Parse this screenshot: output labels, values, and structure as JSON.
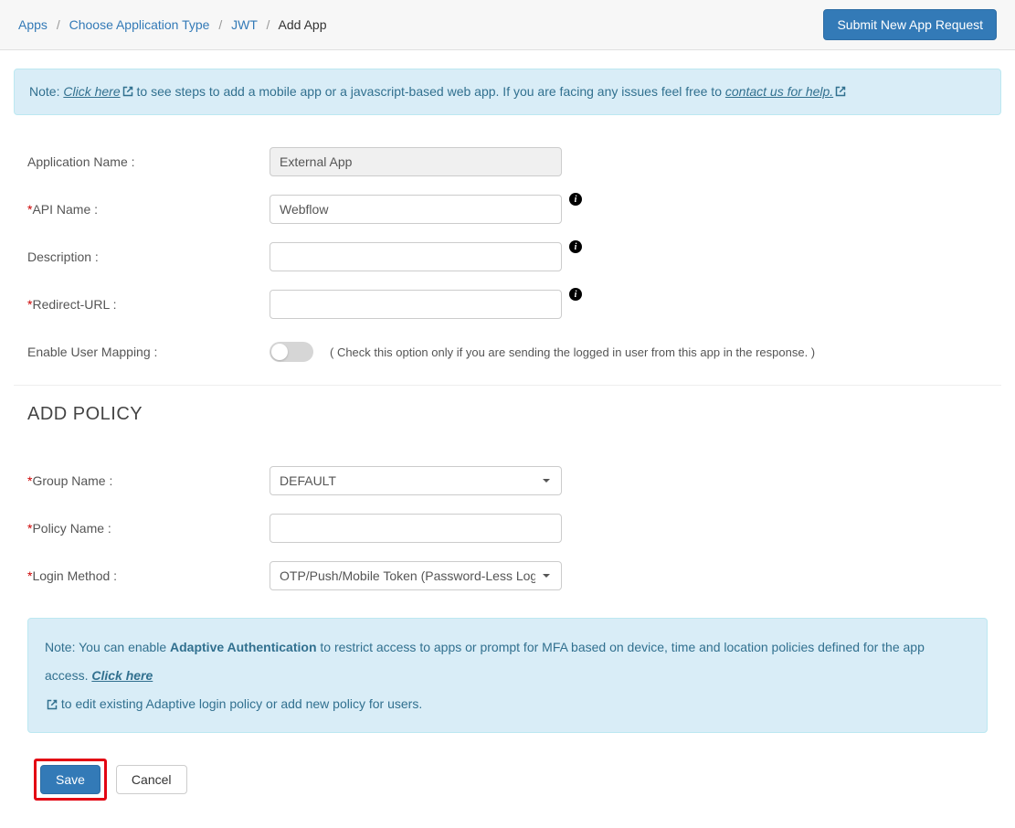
{
  "breadcrumb": {
    "apps": "Apps",
    "choose": "Choose Application Type",
    "jwt": "JWT",
    "current": "Add App"
  },
  "header": {
    "submit_label": "Submit New App Request"
  },
  "note1": {
    "prefix": "Note: ",
    "click_here": "Click here",
    "middle": " to see steps to add a mobile app or a javascript-based web app. If you are facing any issues feel free to ",
    "contact": "contact us for help."
  },
  "form": {
    "app_name_label": "Application Name :",
    "app_name_value": "External App",
    "api_name_label": "API Name :",
    "api_name_value": "Webflow",
    "description_label": "Description :",
    "description_value": "",
    "redirect_label": "Redirect-URL :",
    "redirect_value": "",
    "enable_mapping_label": "Enable User Mapping :",
    "enable_mapping_help": "( Check this option only if you are sending the logged in user from this app in the response. )"
  },
  "policy": {
    "title": "ADD POLICY",
    "group_label": "Group Name :",
    "group_value": "DEFAULT",
    "policy_name_label": "Policy Name :",
    "policy_name_value": "",
    "login_method_label": "Login Method :",
    "login_method_value": "OTP/Push/Mobile Token (Password-Less Login"
  },
  "note2": {
    "prefix": "Note: You can enable ",
    "strong": "Adaptive Authentication",
    "middle": " to restrict access to apps or prompt for MFA based on device, time and location policies defined for the app access. ",
    "click_here": "Click here",
    "suffix": " to edit existing Adaptive login policy or add new policy for users."
  },
  "buttons": {
    "save": "Save",
    "cancel": "Cancel"
  }
}
